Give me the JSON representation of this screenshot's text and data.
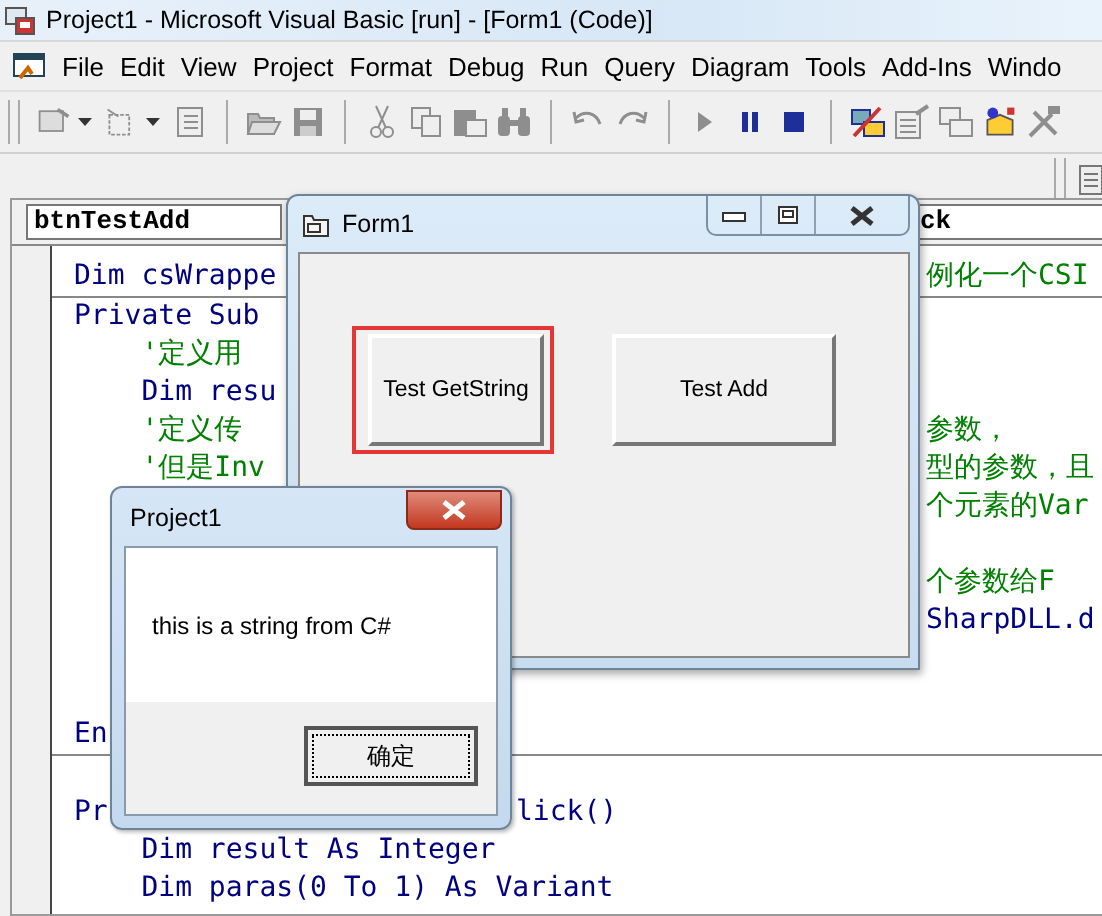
{
  "window": {
    "title": "Project1 - Microsoft Visual Basic [run] - [Form1 (Code)]"
  },
  "menu": [
    "File",
    "Edit",
    "View",
    "Project",
    "Format",
    "Debug",
    "Run",
    "Query",
    "Diagram",
    "Tools",
    "Add-Ins",
    "Windo"
  ],
  "toolbar": [
    {
      "kind": "form",
      "disabled": true
    },
    {
      "kind": "caret"
    },
    {
      "kind": "module",
      "disabled": true
    },
    {
      "kind": "caret"
    },
    {
      "kind": "menu-editor",
      "disabled": true
    },
    {
      "kind": "separator"
    },
    {
      "kind": "open",
      "disabled": true
    },
    {
      "kind": "save",
      "disabled": true
    },
    {
      "kind": "separator"
    },
    {
      "kind": "cut",
      "disabled": true
    },
    {
      "kind": "copy",
      "disabled": true
    },
    {
      "kind": "paste",
      "disabled": true
    },
    {
      "kind": "find",
      "disabled": true
    },
    {
      "kind": "separator"
    },
    {
      "kind": "undo",
      "disabled": true
    },
    {
      "kind": "redo",
      "disabled": true
    },
    {
      "kind": "separator"
    },
    {
      "kind": "start",
      "disabled": true
    },
    {
      "kind": "pause",
      "disabled": false
    },
    {
      "kind": "stop",
      "disabled": false
    },
    {
      "kind": "separator"
    },
    {
      "kind": "project",
      "disabled": false
    },
    {
      "kind": "properties",
      "disabled": true
    },
    {
      "kind": "layout",
      "disabled": true
    },
    {
      "kind": "browser",
      "disabled": false
    },
    {
      "kind": "toolbox",
      "disabled": true
    }
  ],
  "code_window": {
    "object_box": "btnTestAdd",
    "procedure_box": "ck",
    "blocks": [
      [
        {
          "text": "Dim csWrappe",
          "kind": "code",
          "tail": {
            "text": "例化一个CSI",
            "kind": "comment"
          }
        }
      ],
      [
        {
          "text": "Private Sub ",
          "kind": "code"
        },
        {
          "text": "    '定义用",
          "kind": "comment"
        },
        {
          "text": "    Dim resu",
          "kind": "code"
        },
        {
          "text": "    '定义传",
          "kind": "comment",
          "tail": {
            "text": "参数，",
            "kind": "comment"
          }
        },
        {
          "text": "    '但是Inv",
          "kind": "comment",
          "tail": {
            "text": "型的参数，且",
            "kind": "comment"
          }
        },
        {
          "kind": "blank",
          "tail": {
            "text": "个元素的Var",
            "kind": "comment"
          }
        },
        {
          "kind": "blank"
        },
        {
          "kind": "blank",
          "tail": {
            "text": "个参数给F",
            "kind": "comment"
          }
        },
        {
          "kind": "blank",
          "tail": {
            "text": "SharpDLL.d",
            "kind": "code"
          }
        },
        {
          "kind": "blank"
        },
        {
          "kind": "blank"
        },
        {
          "text": "En",
          "kind": "code"
        }
      ],
      [
        {
          "kind": "blank"
        },
        {
          "text": "Pr",
          "kind": "code",
          "tail": {
            "text": "lick()",
            "kind": "code"
          }
        },
        {
          "text": "    Dim result As Integer",
          "kind": "code"
        },
        {
          "text": "    Dim paras(0 To 1) As Variant",
          "kind": "code"
        }
      ]
    ]
  },
  "form_window": {
    "title": "Form1",
    "buttons": [
      {
        "label": "Test GetString",
        "focused": true
      },
      {
        "label": "Test Add",
        "focused": false
      }
    ]
  },
  "message_box": {
    "title": "Project1",
    "message": "this is a string from C#",
    "button": "确定"
  }
}
